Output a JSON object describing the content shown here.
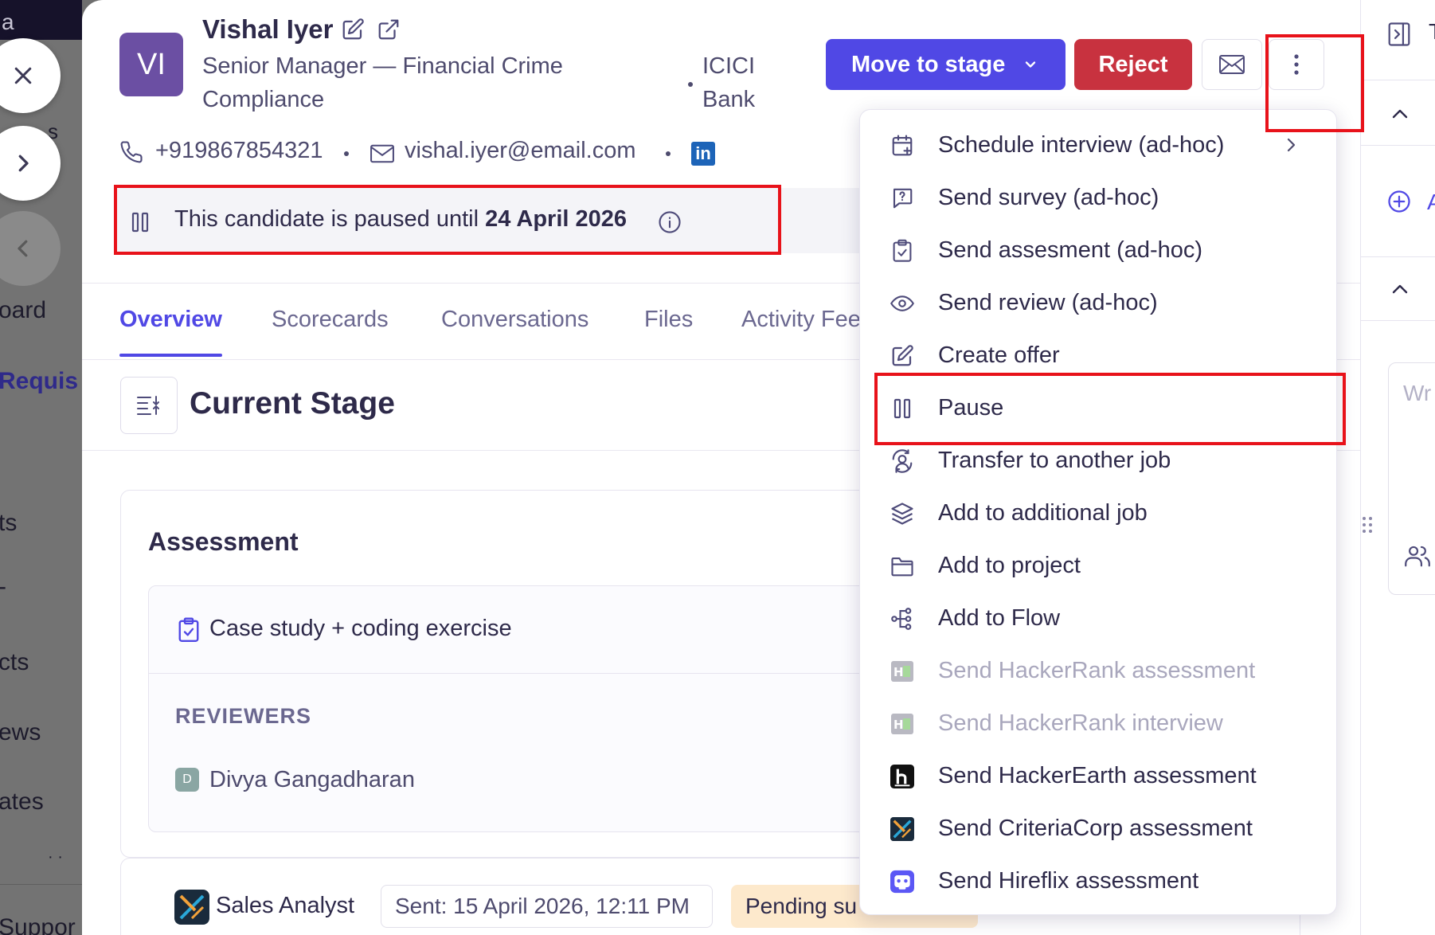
{
  "sidebar": {
    "top_letter": "a",
    "partial_labels": [
      "s",
      "oard",
      "Requis",
      "ts",
      "-",
      "cts",
      "ews",
      "ates",
      "· ·",
      "Suppor"
    ]
  },
  "candidate": {
    "initials": "VI",
    "name": "Vishal Iyer",
    "title": "Senior Manager — Financial Crime Compliance",
    "company": "ICICI Bank",
    "phone": "+919867854321",
    "email": "vishal.iyer@email.com",
    "linkedin_label": "in"
  },
  "actions": {
    "move_to_stage": "Move to stage",
    "reject": "Reject"
  },
  "pause_banner": {
    "text": "This candidate is paused until ",
    "date": "24 April 2026"
  },
  "tabs": [
    {
      "label": "Overview",
      "active": true
    },
    {
      "label": "Scorecards"
    },
    {
      "label": "Conversations"
    },
    {
      "label": "Files"
    },
    {
      "label": "Activity Fee"
    }
  ],
  "stage": {
    "title": "Current Stage"
  },
  "assessment": {
    "title": "Assessment",
    "case": "Case study + coding exercise",
    "reviewers_label": "REVIEWERS",
    "reviewer_initial": "D",
    "reviewer_name": "Divya Gangadharan"
  },
  "second_card": {
    "name": "Sales Analyst",
    "sent": "Sent: 15 April 2026, 12:11 PM",
    "status": "Pending su"
  },
  "menu": {
    "items": [
      {
        "label": "Schedule interview (ad-hoc)",
        "icon": "calendar-plus-icon",
        "submenu": true
      },
      {
        "label": "Send survey (ad-hoc)",
        "icon": "chat-question-icon"
      },
      {
        "label": "Send assesment (ad-hoc)",
        "icon": "clipboard-check-icon"
      },
      {
        "label": "Send review (ad-hoc)",
        "icon": "eye-icon"
      },
      {
        "label": "Create offer",
        "icon": "edit-icon"
      },
      {
        "label": "Pause",
        "icon": "pause-icon"
      },
      {
        "label": "Transfer to another job",
        "icon": "user-transfer-icon"
      },
      {
        "label": "Add to additional job",
        "icon": "layers-icon"
      },
      {
        "label": "Add to project",
        "icon": "folder-icon"
      },
      {
        "label": "Add to Flow",
        "icon": "flow-icon"
      },
      {
        "label": "Send HackerRank assessment",
        "icon": "hackerrank-icon",
        "disabled": true
      },
      {
        "label": "Send HackerRank interview",
        "icon": "hackerrank-icon",
        "disabled": true
      },
      {
        "label": "Send HackerEarth assessment",
        "icon": "hackerearth-icon"
      },
      {
        "label": "Send CriteriaCorp assessment",
        "icon": "criteriacorp-icon"
      },
      {
        "label": "Send Hireflix assessment",
        "icon": "hireflix-icon"
      }
    ]
  },
  "right_panel": {
    "partial_text": "Wr",
    "partial_add": "A",
    "partial_top": "T"
  },
  "colors": {
    "primary": "#5048e5",
    "danger": "#c8323f",
    "highlight": "#e8121a",
    "pending_bg": "#fde9cc"
  }
}
